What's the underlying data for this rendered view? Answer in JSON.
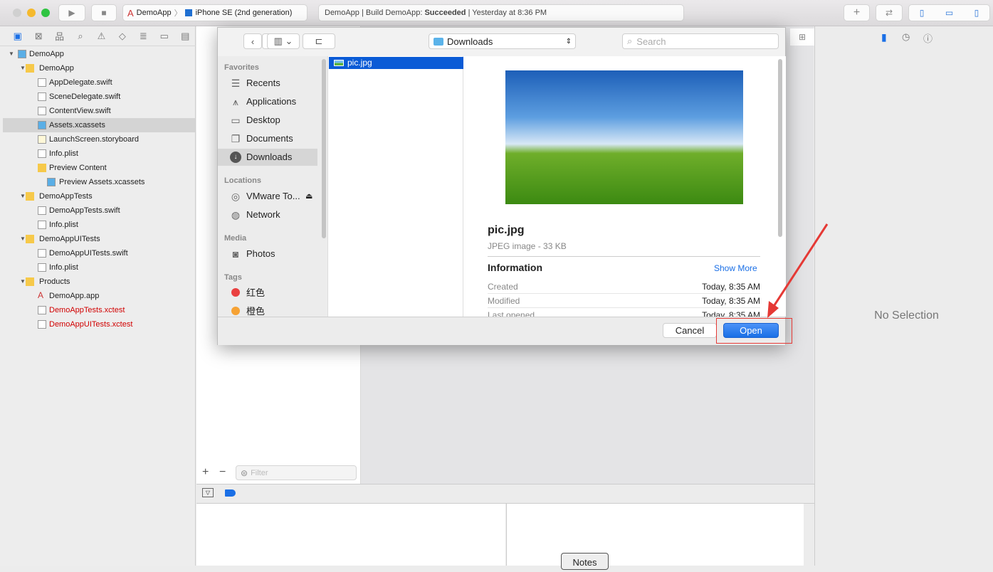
{
  "toolbar": {
    "scheme": "DemoApp",
    "device": "iPhone SE (2nd generation)",
    "status_prefix": "DemoApp | Build DemoApp: ",
    "status_result": "Succeeded",
    "status_suffix": " | Yesterday at 8:36 PM"
  },
  "navigator": {
    "items": [
      {
        "label": "DemoApp",
        "level": 0,
        "type": "project",
        "expanded": true
      },
      {
        "label": "DemoApp",
        "level": 1,
        "type": "folder",
        "expanded": true
      },
      {
        "label": "AppDelegate.swift",
        "level": 2,
        "type": "swift"
      },
      {
        "label": "SceneDelegate.swift",
        "level": 2,
        "type": "swift"
      },
      {
        "label": "ContentView.swift",
        "level": 2,
        "type": "swift"
      },
      {
        "label": "Assets.xcassets",
        "level": 2,
        "type": "assets",
        "selected": true
      },
      {
        "label": "LaunchScreen.storyboard",
        "level": 2,
        "type": "storyboard"
      },
      {
        "label": "Info.plist",
        "level": 2,
        "type": "plist"
      },
      {
        "label": "Preview Content",
        "level": 2,
        "type": "folder",
        "expanded": true
      },
      {
        "label": "Preview Assets.xcassets",
        "level": 3,
        "type": "assets"
      },
      {
        "label": "DemoAppTests",
        "level": 1,
        "type": "folder",
        "expanded": true
      },
      {
        "label": "DemoAppTests.swift",
        "level": 2,
        "type": "swift"
      },
      {
        "label": "Info.plist",
        "level": 2,
        "type": "plist"
      },
      {
        "label": "DemoAppUITests",
        "level": 1,
        "type": "folder",
        "expanded": true
      },
      {
        "label": "DemoAppUITests.swift",
        "level": 2,
        "type": "swift"
      },
      {
        "label": "Info.plist",
        "level": 2,
        "type": "plist"
      },
      {
        "label": "Products",
        "level": 1,
        "type": "folder",
        "expanded": true
      },
      {
        "label": "DemoApp.app",
        "level": 2,
        "type": "app"
      },
      {
        "label": "DemoAppTests.xctest",
        "level": 2,
        "type": "xctest",
        "missing": true
      },
      {
        "label": "DemoAppUITests.xctest",
        "level": 2,
        "type": "xctest",
        "missing": true
      }
    ]
  },
  "assets": {
    "filter_placeholder": "Filter"
  },
  "inspector": {
    "empty": "No Selection"
  },
  "debug": {
    "notes": "Notes"
  },
  "dialog": {
    "location": "Downloads",
    "search_placeholder": "Search",
    "sidebar": {
      "favorites": "Favorites",
      "fav_items": [
        "Recents",
        "Applications",
        "Desktop",
        "Documents",
        "Downloads"
      ],
      "locations": "Locations",
      "loc_items": [
        "VMware To...",
        "Network"
      ],
      "media": "Media",
      "media_items": [
        "Photos"
      ],
      "tags": "Tags",
      "tag_items": [
        {
          "label": "红色",
          "color": "#e94040"
        },
        {
          "label": "橙色",
          "color": "#f6a234"
        }
      ]
    },
    "files": [
      "pic.jpg"
    ],
    "preview": {
      "name": "pic.jpg",
      "kind": "JPEG image - 33 KB",
      "info_title": "Information",
      "show_more": "Show More",
      "rows": [
        {
          "k": "Created",
          "v": "Today, 8:35 AM"
        },
        {
          "k": "Modified",
          "v": "Today, 8:35 AM"
        },
        {
          "k": "Last opened",
          "v": "Today, 8:35 AM"
        }
      ]
    },
    "cancel": "Cancel",
    "open": "Open"
  },
  "colors": {
    "accent": "#1a6fe6",
    "selection": "#0a5bd6",
    "annotation": "#e53935"
  }
}
